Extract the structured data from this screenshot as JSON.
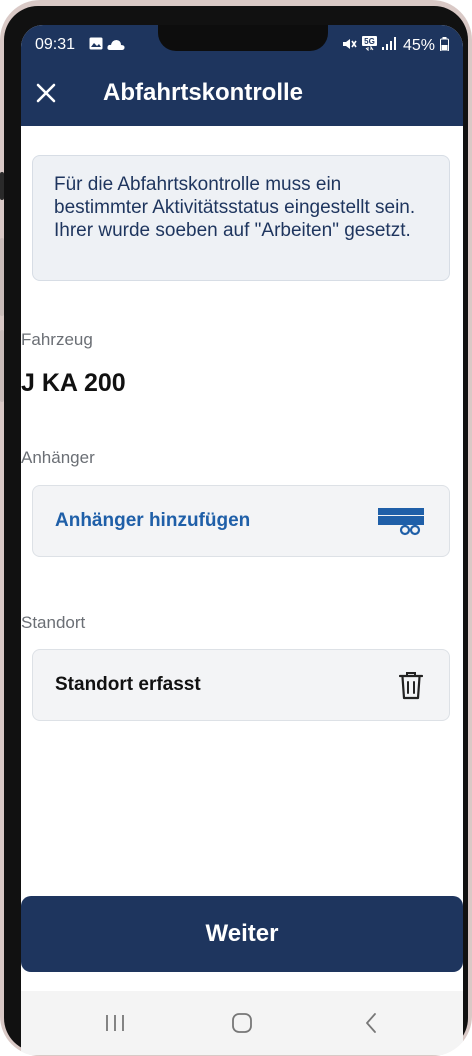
{
  "status_bar": {
    "time": "09:31",
    "battery": "45%",
    "icons": [
      "image-icon",
      "cloud-icon",
      "mute-icon",
      "5g-icon",
      "signal-icon",
      "battery-icon"
    ]
  },
  "header": {
    "close_icon": "close-icon",
    "title": "Abfahrtskontrolle"
  },
  "info": {
    "text": "Für die Abfahrtskontrolle muss ein bestimmter Aktivitätsstatus eingestellt sein. Ihrer wurde soeben auf \"Arbeiten\" gesetzt."
  },
  "vehicle": {
    "label": "Fahrzeug",
    "value": "J KA 200"
  },
  "trailer": {
    "label": "Anhänger",
    "action": "Anhänger hinzufügen",
    "icon": "trailer-icon"
  },
  "location": {
    "label": "Standort",
    "value": "Standort erfasst",
    "icon": "trash-icon"
  },
  "footer": {
    "next_label": "Weiter"
  },
  "nav": {
    "icons": [
      "recent-apps-icon",
      "home-icon",
      "back-icon"
    ]
  },
  "colors": {
    "primary": "#1e355e",
    "link": "#1f5fa8",
    "card_bg": "#f3f4f6"
  }
}
